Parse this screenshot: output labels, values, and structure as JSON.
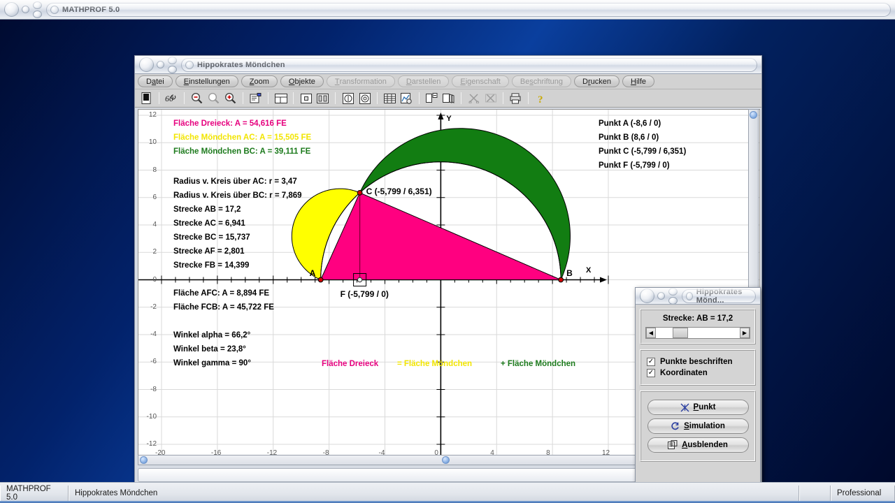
{
  "app": {
    "title": "MATHPROF 5.0"
  },
  "child_window": {
    "title": "Hippokrates Möndchen",
    "menu": [
      {
        "label": "Datei",
        "accel": "a",
        "enabled": true
      },
      {
        "label": "Einstellungen",
        "accel": "E",
        "enabled": true
      },
      {
        "label": "Zoom",
        "accel": "Z",
        "enabled": true
      },
      {
        "label": "Objekte",
        "accel": "O",
        "enabled": true
      },
      {
        "label": "Transformation",
        "accel": "T",
        "enabled": false
      },
      {
        "label": "Darstellen",
        "accel": "D",
        "enabled": false
      },
      {
        "label": "Eigenschaft",
        "accel": "E",
        "enabled": false
      },
      {
        "label": "Beschriftung",
        "accel": "s",
        "enabled": false
      },
      {
        "label": "Drucken",
        "accel": "r",
        "enabled": true
      },
      {
        "label": "Hilfe",
        "accel": "H",
        "enabled": true
      }
    ],
    "toolbar_icons": [
      "panel-icon",
      "angle-60-icon",
      "zoom-out-icon",
      "zoom-reset-icon",
      "zoom-in-icon",
      "properties-icon",
      "split-view-icon",
      "single-cell-icon",
      "two-column-icon",
      "circle-info-icon",
      "target-icon",
      "table-icon",
      "chart-sheet-icon",
      "copy-page-icon",
      "layers-icon",
      "scissors-icon",
      "scissors-alt-icon",
      "print-icon",
      "help-key-icon"
    ]
  },
  "plot": {
    "x_ticks": [
      "-20",
      "-16",
      "-12",
      "-8",
      "-4",
      "0",
      "4",
      "8",
      "12"
    ],
    "y_ticks": [
      "12",
      "10",
      "8",
      "6",
      "4",
      "2",
      "0",
      "-2",
      "-4",
      "-6",
      "-8",
      "-10",
      "-12"
    ],
    "axis_label_x": "X",
    "axis_label_y": "Y",
    "results_block_1": [
      {
        "text": "Fläche Dreieck: A = 54,616 FE",
        "color": "#E6007E"
      },
      {
        "text": "Fläche Möndchen AC: A = 15,505 FE",
        "color": "#F2E500"
      },
      {
        "text": "Fläche Möndchen BC: A = 39,111 FE",
        "color": "#1C7A1C"
      }
    ],
    "results_block_2": [
      "Radius v. Kreis über AC:  r = 3,47",
      "Radius v. Kreis über BC:  r = 7,869",
      "Strecke AB = 17,2",
      "Strecke AC = 6,941",
      "Strecke BC = 15,737",
      "Strecke AF = 2,801",
      "Strecke FB = 14,399"
    ],
    "results_block_3": [
      "Fläche AFC: A = 8,894 FE",
      "Fläche FCB: A = 45,722 FE"
    ],
    "results_block_4": [
      "Winkel alpha = 66,2°",
      "Winkel beta = 23,8°",
      "Winkel gamma = 90°"
    ],
    "points_block": [
      "Punkt A (-8,6 / 0)",
      "Punkt B (8,6 / 0)",
      "Punkt C (-5,799 / 6,351)",
      "Punkt F (-5,799 / 0)"
    ],
    "point_labels": {
      "a": "A",
      "b": "B",
      "c": "C (-5,799 / 6,351)",
      "f": "F (-5,799 / 0)"
    },
    "legend": [
      {
        "text": "Fläche Dreieck",
        "color": "#E6007E"
      },
      {
        "text": "= Fläche Möndchen",
        "color": "#F2E500"
      },
      {
        "text": "+ Fläche Möndchen",
        "color": "#1C7A1C"
      }
    ],
    "colors": {
      "triangle": "#FF0080",
      "lune_ac": "#FFFF00",
      "lune_bc": "#127D12",
      "point": "#D00000",
      "grid": "#D9D9D9",
      "axis": "#000000"
    }
  },
  "chart_data": {
    "type": "scatter",
    "title": "Hippokrates Möndchen",
    "xlabel": "X",
    "ylabel": "Y",
    "xlim": [
      -21.4,
      13.6
    ],
    "ylim": [
      -12.6,
      12.6
    ],
    "grid": true,
    "points": [
      {
        "name": "A",
        "x": -8.6,
        "y": 0
      },
      {
        "name": "B",
        "x": 8.6,
        "y": 0
      },
      {
        "name": "C",
        "x": -5.799,
        "y": 6.351
      },
      {
        "name": "F",
        "x": -5.799,
        "y": 0
      }
    ],
    "measures": {
      "area_triangle": 54.616,
      "area_lune_ac": 15.505,
      "area_lune_bc": 39.111,
      "radius_circle_ac": 3.47,
      "radius_circle_bc": 7.869,
      "segment_ab": 17.2,
      "segment_ac": 6.941,
      "segment_bc": 15.737,
      "segment_af": 2.801,
      "segment_fb": 14.399,
      "area_afc": 8.894,
      "area_fcb": 45.722,
      "angle_alpha": 66.2,
      "angle_beta": 23.8,
      "angle_gamma": 90
    }
  },
  "control_window": {
    "title": "Hippokrates Mönd...",
    "slider_label": "Strecke:  AB = 17,2",
    "checkboxes": [
      {
        "label": "Punkte beschriften",
        "checked": true
      },
      {
        "label": "Koordinaten",
        "checked": true
      }
    ],
    "buttons": [
      {
        "label": "Punkt",
        "icon": "crosshair-icon"
      },
      {
        "label": "Simulation",
        "icon": "refresh-icon"
      },
      {
        "label": "Ausblenden",
        "icon": "hide-window-icon"
      }
    ]
  },
  "taskbar": {
    "left_cell": "MATHPROF 5.0",
    "doc_cell": "Hippokrates Möndchen",
    "right_cell": "Professional"
  }
}
